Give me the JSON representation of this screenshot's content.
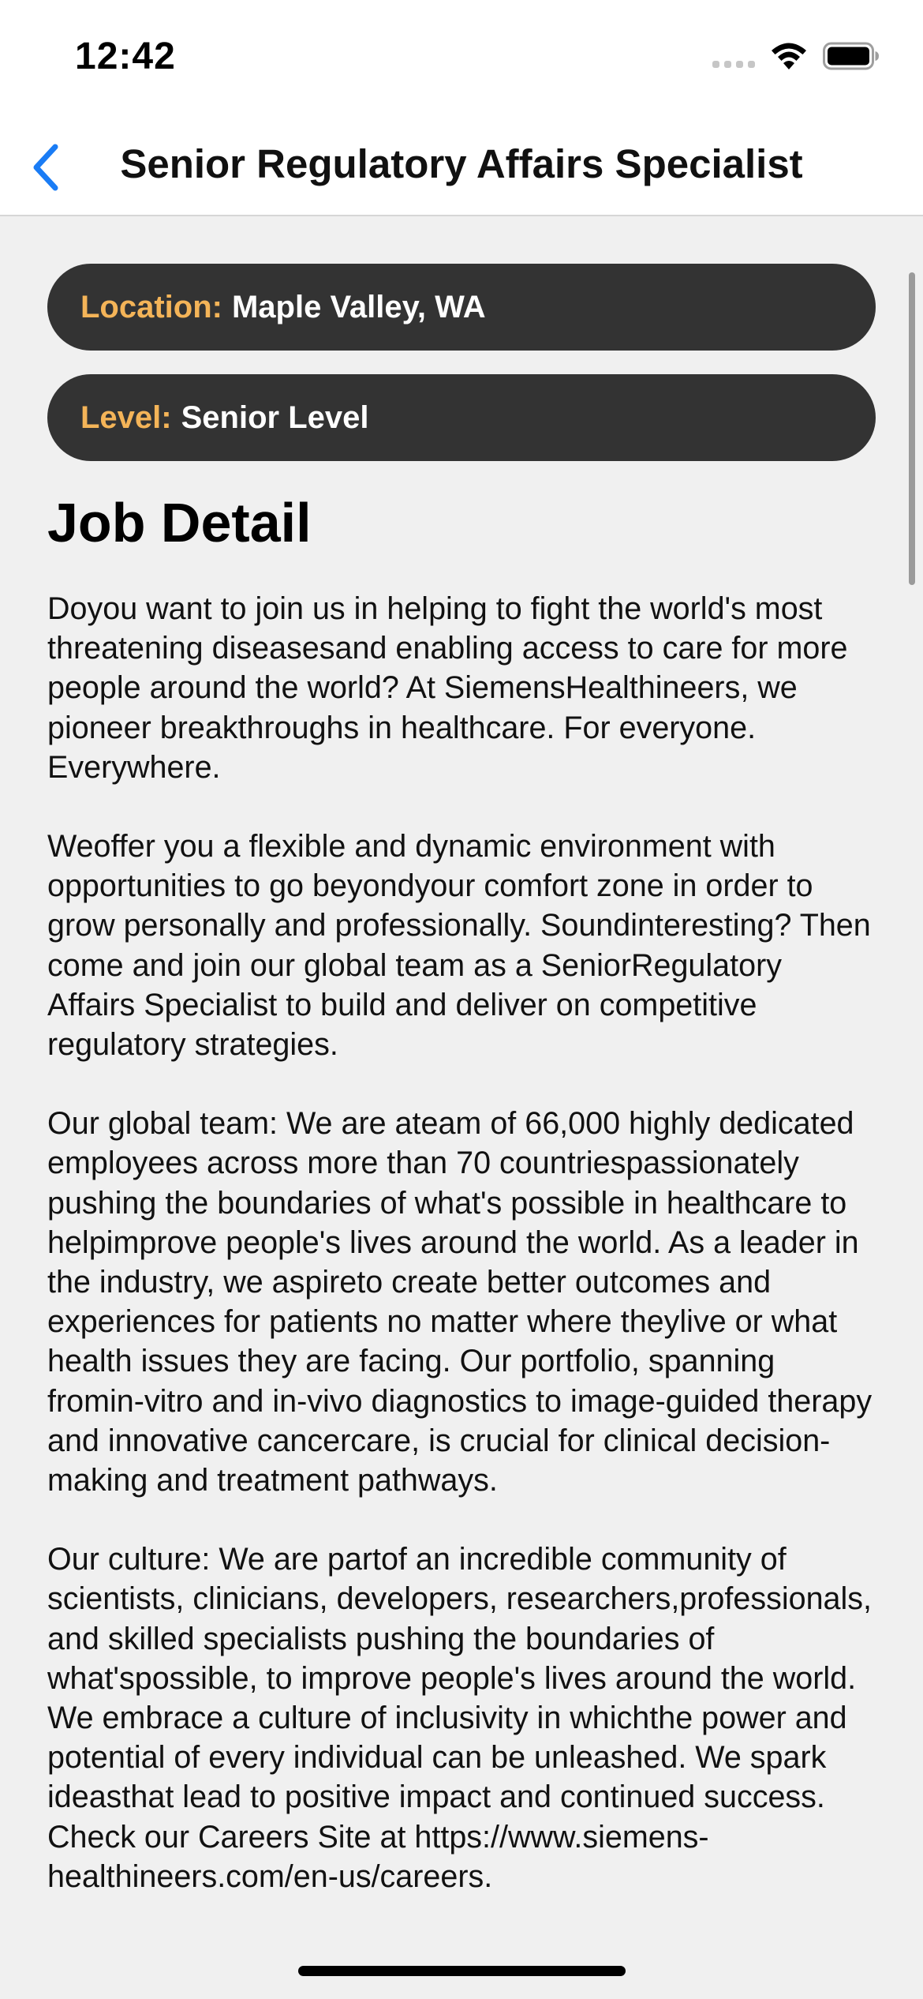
{
  "status_bar": {
    "time": "12:42",
    "icons": [
      "signal-icon",
      "wifi-icon",
      "battery-icon"
    ]
  },
  "nav": {
    "title": "Senior Regulatory Affairs Specialist",
    "back_icon": "chevron-left-icon",
    "accent_color": "#1a7cf5"
  },
  "pills": {
    "location": {
      "label": "Location:",
      "value": "Maple Valley, WA"
    },
    "level": {
      "label": "Level:",
      "value": "Senior Level"
    },
    "label_color": "#f4b458",
    "background_color": "#333333"
  },
  "job_detail": {
    "title": "Job Detail",
    "paragraphs": [
      "Doyou want to join us in helping to fight the world's most threatening diseasesand enabling access to care for more people around the world? At SiemensHealthineers, we pioneer breakthroughs in healthcare. For everyone. Everywhere.",
      "Weoffer you a flexible and dynamic environment with opportunities to go beyondyour comfort zone in order to grow personally and professionally. Soundinteresting? Then come and join our global team as a SeniorRegulatory Affairs Specialist to build and deliver on competitive regulatory strategies.",
      "Our global team: We are ateam of 66,000 highly dedicated employees across more than 70 countriespassionately pushing the boundaries of what's possible in healthcare to helpimprove people's lives around the world. As a leader in the industry, we aspireto create better outcomes and experiences for patients no matter where theylive or what health issues they are facing. Our portfolio, spanning fromin-vitro and in-vivo diagnostics to image-guided therapy and innovative cancercare, is crucial for clinical decision-making and treatment pathways.",
      "Our culture: We are partof an incredible community of scientists, clinicians, developers, researchers,professionals, and skilled specialists pushing the boundaries of what'spossible, to improve people's lives around the world. We embrace a culture of inclusivity in whichthe power and potential of every individual can be unleashed. We spark ideasthat lead to positive impact and continued success. Check our Careers Site at https://www.siemens-healthineers.com/en-us/careers."
    ]
  }
}
